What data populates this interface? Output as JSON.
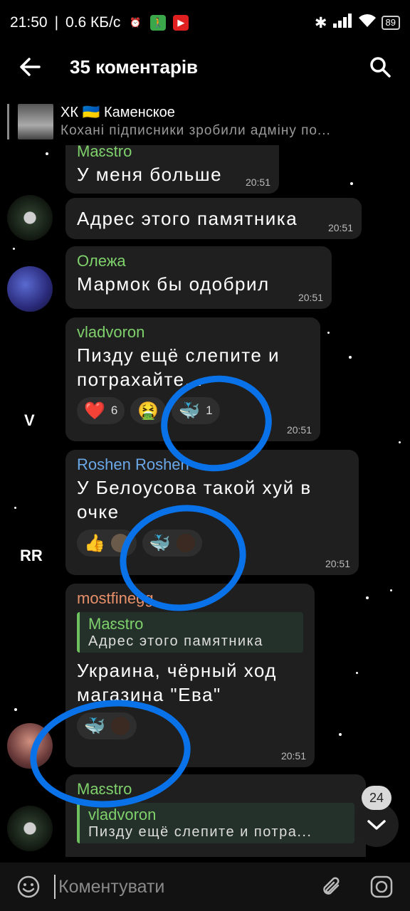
{
  "status_bar": {
    "time": "21:50",
    "separator": "|",
    "speed": "0.6 КБ/с",
    "battery": "89"
  },
  "header": {
    "title": "35 коментарів"
  },
  "pinned": {
    "title": "ХК 🇺🇦 Каменское",
    "message": "Кохані підписники зробили адміну по..."
  },
  "messages": [
    {
      "author": "Maɛstro",
      "text": "У меня больше",
      "time": "20:51"
    },
    {
      "author": "",
      "text": "Адрес этого памятника",
      "time": "20:51"
    },
    {
      "author": "Олежа",
      "text": "Мармок бы одобрил",
      "time": "20:51"
    },
    {
      "author": "vladvoron",
      "text": "Пизду ещё слепите и потрахайте...",
      "time": "20:51",
      "reactions": [
        {
          "emoji": "❤️",
          "count": "6"
        },
        {
          "emoji": "🤮",
          "count": ""
        },
        {
          "emoji": "🐳",
          "count": "1"
        }
      ],
      "avatar_letter": "V"
    },
    {
      "author": "Roshen Roshen",
      "text": "У Белоусова такой хуй в очке",
      "time": "20:51",
      "reactions": [
        {
          "emoji": "👍",
          "count": ""
        },
        {
          "emoji": "🐳",
          "count": ""
        }
      ],
      "avatar_letter": "RR"
    },
    {
      "author": "mostfinegg",
      "quote_author": "Maɛstro",
      "quote_text": "Адрес этого памятника",
      "text": "Украина, чёрный ход магазина \"Ева\"",
      "time": "20:51",
      "reactions": [
        {
          "emoji": "🐳",
          "count": ""
        }
      ]
    },
    {
      "author": "Maɛstro",
      "quote_author": "vladvoron",
      "quote_text": "Пизду ещё слепите и потра..."
    }
  ],
  "scroll": {
    "unread_count": "24"
  },
  "input": {
    "placeholder": "Коментувати"
  },
  "colors": {
    "background": "#000000",
    "bubble": "#1f1f1f",
    "annotation": "#0a72e8",
    "name_green": "#7fd16c",
    "name_blue": "#6ba8e8",
    "name_orange": "#e8906a"
  }
}
